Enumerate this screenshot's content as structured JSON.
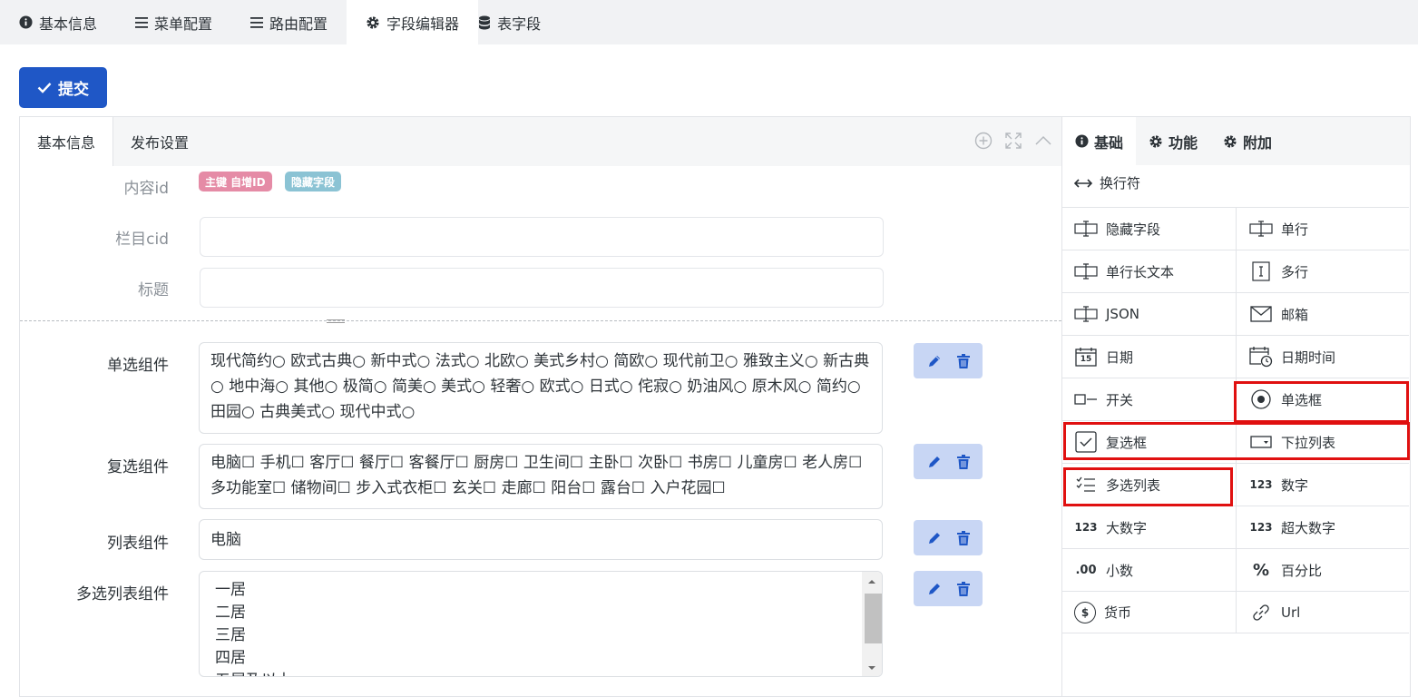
{
  "top_tabs": [
    {
      "label": "基本信息",
      "icon": "info-circle-icon"
    },
    {
      "label": "菜单配置",
      "icon": "menu-icon"
    },
    {
      "label": "路由配置",
      "icon": "menu-icon"
    },
    {
      "label": "字段编辑器",
      "icon": "gear-icon"
    },
    {
      "label": "表字段",
      "icon": "database-icon"
    }
  ],
  "submit_label": "提交",
  "form_tabs": [
    "基本信息",
    "发布设置"
  ],
  "basic_fields": [
    {
      "label": "内容id"
    },
    {
      "label": "栏目cid",
      "value": ""
    },
    {
      "label": "标题",
      "value": ""
    }
  ],
  "badges": [
    {
      "text": "主键 自增ID",
      "color": "#e58ba6"
    },
    {
      "text": "隐藏字段",
      "color": "#8bc3d4"
    }
  ],
  "components": [
    {
      "label": "单选组件",
      "text": "现代简约○ 欧式古典○ 新中式○ 法式○ 北欧○ 美式乡村○ 简欧○ 现代前卫○ 雅致主义○ 新古典○ 地中海○ 其他○ 极简○ 简美○ 美式○ 轻奢○ 欧式○ 日式○ 侘寂○ 奶油风○ 原木风○ 简约○ 田园○ 古典美式○ 现代中式○"
    },
    {
      "label": "复选组件",
      "text": "电脑☐ 手机☐ 客厅☐ 餐厅☐ 客餐厅☐ 厨房☐ 卫生间☐ 主卧☐ 次卧☐ 书房☐ 儿童房☐ 老人房☐ 多功能室☐ 储物间☐ 步入式衣柜☐ 玄关☐ 走廊☐ 阳台☐ 露台☐ 入户花园☐"
    },
    {
      "label": "列表组件",
      "text": "电脑"
    },
    {
      "label": "多选列表组件",
      "options": [
        "一居",
        "二居",
        "三居",
        "四居",
        "五居及以上"
      ]
    }
  ],
  "right_tabs": [
    {
      "label": "基础",
      "icon": "info-circle-icon"
    },
    {
      "label": "功能",
      "icon": "gear-icon"
    },
    {
      "label": "附加",
      "icon": "gear-icon"
    }
  ],
  "newline": {
    "label": "换行符",
    "icon": "arrows-horizontal-icon"
  },
  "widgets": [
    {
      "label": "隐藏字段",
      "icon": "text-cursor-icon"
    },
    {
      "label": "单行",
      "icon": "text-cursor-icon"
    },
    {
      "label": "单行长文本",
      "icon": "text-cursor-icon"
    },
    {
      "label": "多行",
      "icon": "textarea-icon"
    },
    {
      "label": "JSON",
      "icon": "text-cursor-icon"
    },
    {
      "label": "邮箱",
      "icon": "envelope-icon"
    },
    {
      "label": "日期",
      "icon": "calendar-icon",
      "icon_text": "15"
    },
    {
      "label": "日期时间",
      "icon": "calendar-clock-icon"
    },
    {
      "label": "开关",
      "icon": "toggle-icon"
    },
    {
      "label": "单选框",
      "icon": "radio-icon"
    },
    {
      "label": "复选框",
      "icon": "checkbox-icon"
    },
    {
      "label": "下拉列表",
      "icon": "select-icon"
    },
    {
      "label": "多选列表",
      "icon": "checklist-icon"
    },
    {
      "label": "数字",
      "icon": "number-icon",
      "icon_text": "123"
    },
    {
      "label": "大数字",
      "icon": "number-icon",
      "icon_text": "123"
    },
    {
      "label": "超大数字",
      "icon": "number-icon",
      "icon_text": "123"
    },
    {
      "label": "小数",
      "icon": "decimal-icon",
      "icon_text": ".00"
    },
    {
      "label": "百分比",
      "icon": "percent-icon",
      "icon_text": "%"
    },
    {
      "label": "货币",
      "icon": "dollar-icon",
      "icon_text": "$"
    },
    {
      "label": "Url",
      "icon": "link-icon"
    }
  ],
  "highlight_color": "#e01010"
}
